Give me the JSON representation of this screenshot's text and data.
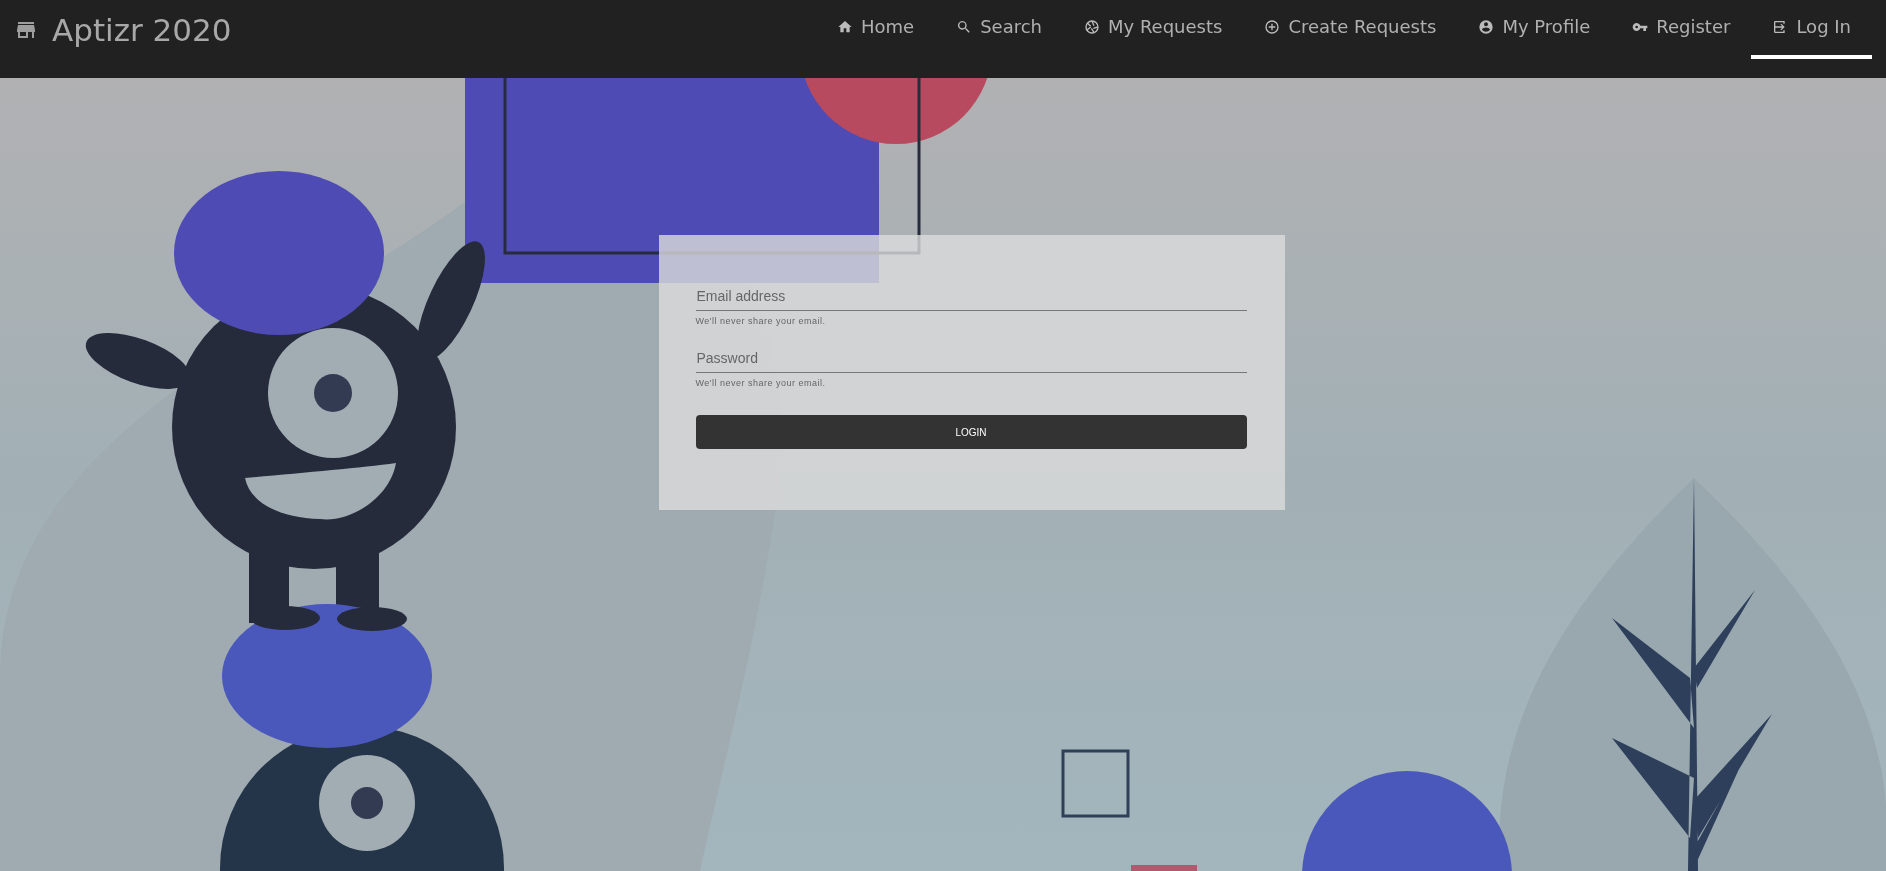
{
  "brand": {
    "title": "Aptizr 2020"
  },
  "nav": [
    {
      "label": "Home",
      "selected": false
    },
    {
      "label": "Search",
      "selected": false
    },
    {
      "label": "My Requests",
      "selected": false
    },
    {
      "label": "Create Requests",
      "selected": false
    },
    {
      "label": "My Profile",
      "selected": false
    },
    {
      "label": "Register",
      "selected": false
    },
    {
      "label": "Log In",
      "selected": true
    }
  ],
  "form": {
    "fields": [
      {
        "placeholder": "Email address",
        "help": "We'll never share your email."
      },
      {
        "placeholder": "Password",
        "help": "We'll never share your email."
      }
    ],
    "button": "LOGIN"
  }
}
